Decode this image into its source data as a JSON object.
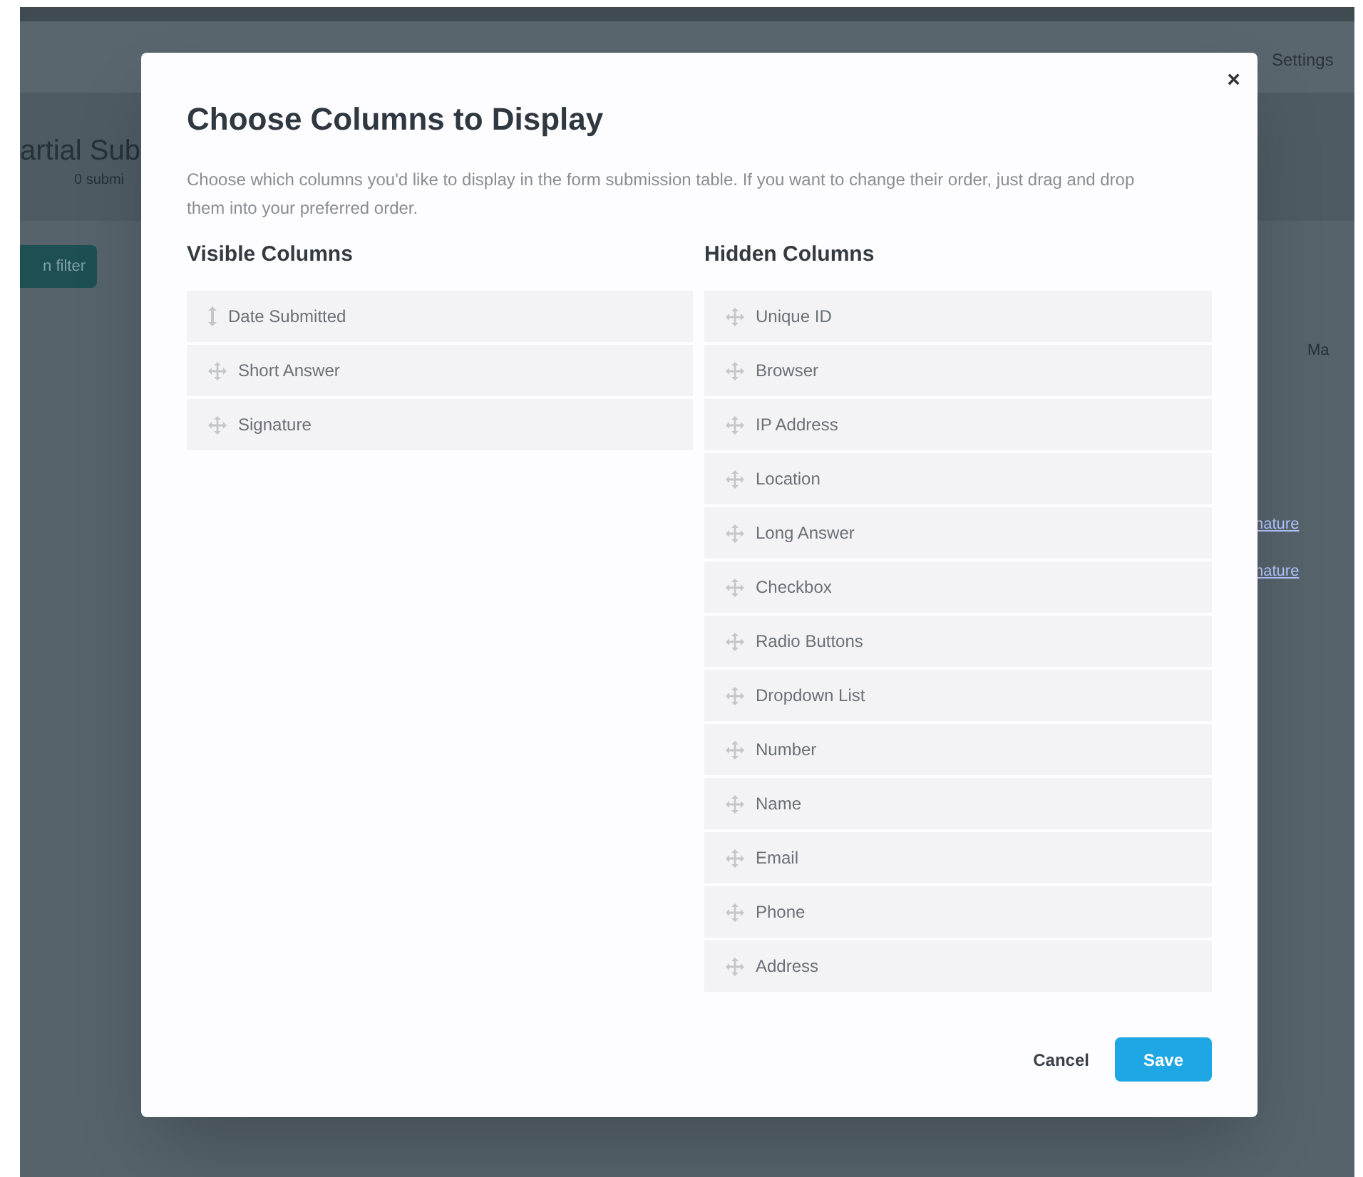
{
  "background": {
    "nav_link": "Settings",
    "page_title": "artial Sub",
    "page_subtitle": "0 submi",
    "filter_button": "n filter",
    "toolbar_link": "Ma",
    "table_links": [
      "nature",
      "nature"
    ]
  },
  "dialog": {
    "title": "Choose Columns to Display",
    "close": "×",
    "description": "Choose which columns you'd like to display in the form submission table. If you want to change their order, just drag and drop them into your preferred order.",
    "visible_columns": {
      "heading": "Visible Columns",
      "items": [
        {
          "label": "Date Submitted",
          "kind": "fixed"
        },
        {
          "label": "Short Answer",
          "kind": "movable"
        },
        {
          "label": "Signature",
          "kind": "movable"
        }
      ]
    },
    "hidden_columns": {
      "heading": "Hidden Columns",
      "items": [
        {
          "label": "Unique ID",
          "kind": "movable"
        },
        {
          "label": "Browser",
          "kind": "movable"
        },
        {
          "label": "IP Address",
          "kind": "movable"
        },
        {
          "label": "Location",
          "kind": "movable"
        },
        {
          "label": "Long Answer",
          "kind": "movable"
        },
        {
          "label": "Checkbox",
          "kind": "movable"
        },
        {
          "label": "Radio Buttons",
          "kind": "movable"
        },
        {
          "label": "Dropdown List",
          "kind": "movable"
        },
        {
          "label": "Number",
          "kind": "movable"
        },
        {
          "label": "Name",
          "kind": "movable"
        },
        {
          "label": "Email",
          "kind": "movable"
        },
        {
          "label": "Phone",
          "kind": "movable"
        },
        {
          "label": "Address",
          "kind": "movable"
        }
      ]
    },
    "buttons": {
      "cancel": "Cancel",
      "save": "Save"
    }
  }
}
